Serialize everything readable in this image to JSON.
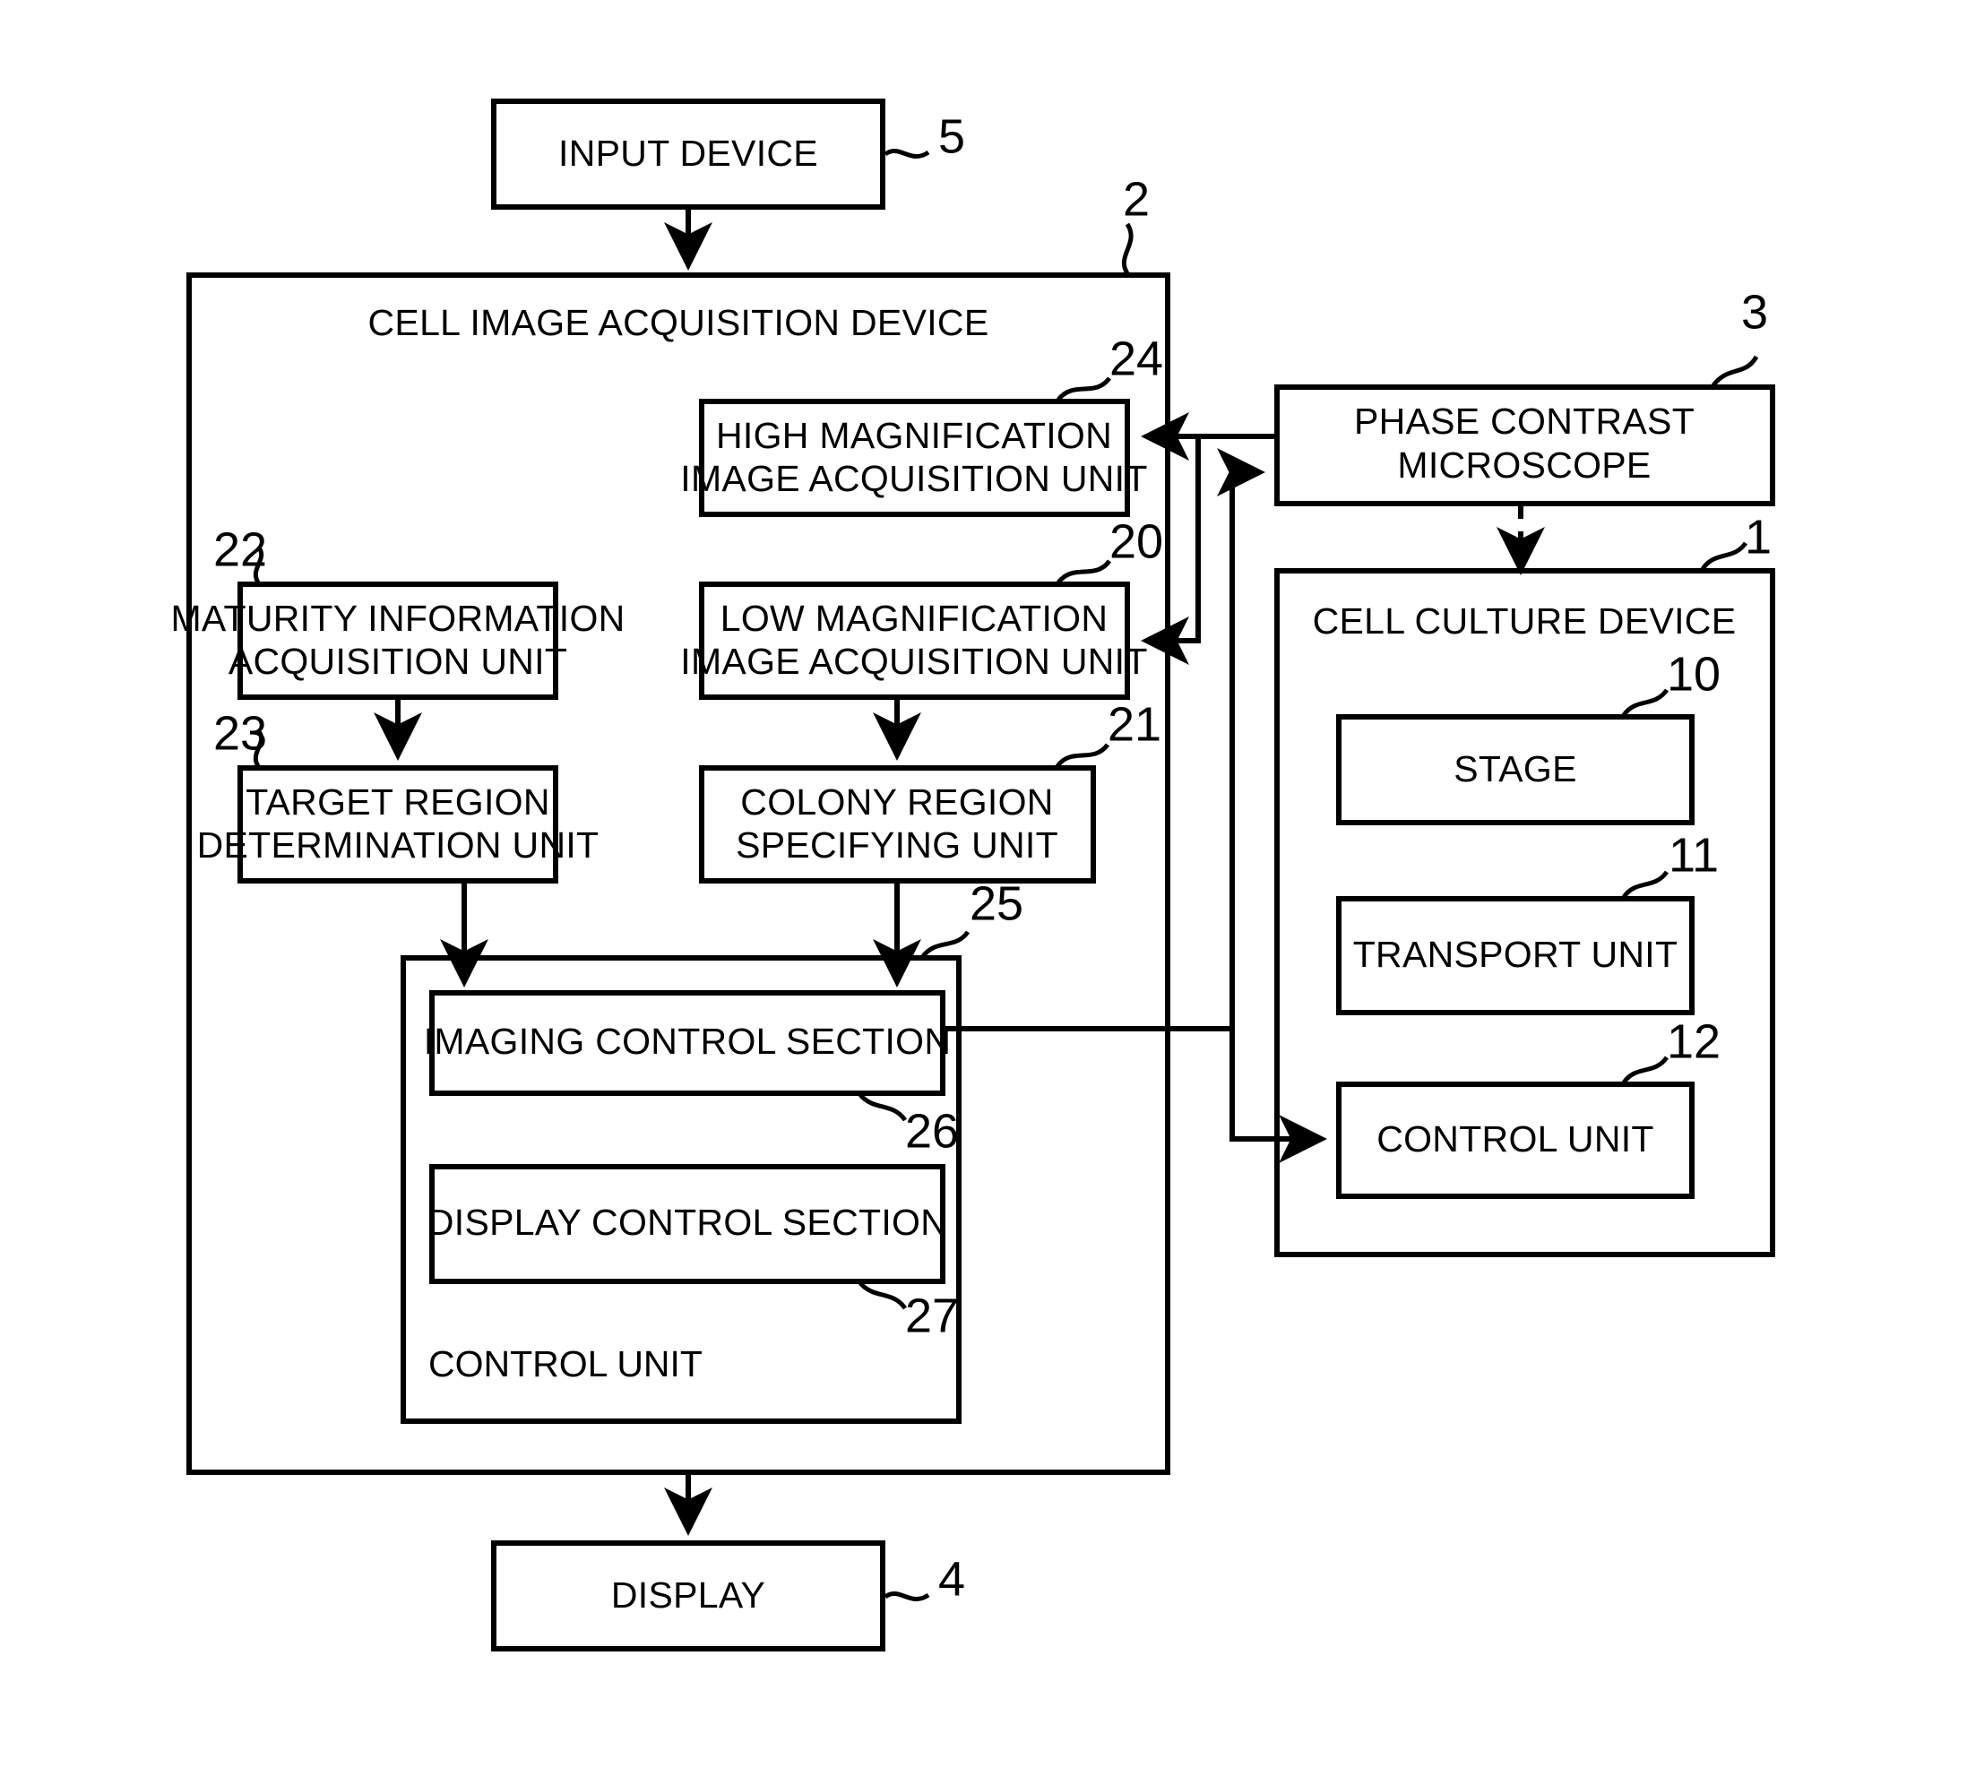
{
  "figure": {
    "type": "patent-block-diagram",
    "title": "Cell image acquisition system block diagram"
  },
  "blocks": {
    "input_device": {
      "label": "INPUT DEVICE",
      "ref": "5"
    },
    "cell_image_acquisition_device": {
      "label": "CELL IMAGE ACQUISITION DEVICE",
      "ref": "2"
    },
    "high_magnification_unit": {
      "line1": "HIGH MAGNIFICATION",
      "line2": "IMAGE ACQUISITION UNIT",
      "ref": "24"
    },
    "maturity_information_unit": {
      "line1": "MATURITY INFORMATION",
      "line2": "ACQUISITION UNIT",
      "ref": "22"
    },
    "low_magnification_unit": {
      "line1": "LOW MAGNIFICATION",
      "line2": "IMAGE ACQUISITION UNIT",
      "ref": "20"
    },
    "target_region_unit": {
      "line1": "TARGET REGION",
      "line2": "DETERMINATION UNIT",
      "ref": "23"
    },
    "colony_region_unit": {
      "line1": "COLONY REGION",
      "line2": "SPECIFYING UNIT",
      "ref": "21"
    },
    "control_unit_outer": {
      "label": "CONTROL UNIT",
      "ref": "25"
    },
    "imaging_control_section": {
      "label": "IMAGING CONTROL SECTION",
      "ref": "26"
    },
    "display_control_section": {
      "label": "DISPLAY CONTROL SECTION",
      "ref": "27"
    },
    "display": {
      "label": "DISPLAY",
      "ref": "4"
    },
    "phase_contrast_microscope": {
      "line1": "PHASE CONTRAST",
      "line2": "MICROSCOPE",
      "ref": "3"
    },
    "cell_culture_device": {
      "label": "CELL CULTURE DEVICE",
      "ref": "1"
    },
    "stage": {
      "label": "STAGE",
      "ref": "10"
    },
    "transport_unit": {
      "label": "TRANSPORT UNIT",
      "ref": "11"
    },
    "culture_control_unit": {
      "label": "CONTROL UNIT",
      "ref": "12"
    }
  },
  "colors": {
    "stroke": "#000000",
    "background": "#ffffff",
    "text": "#000000"
  }
}
